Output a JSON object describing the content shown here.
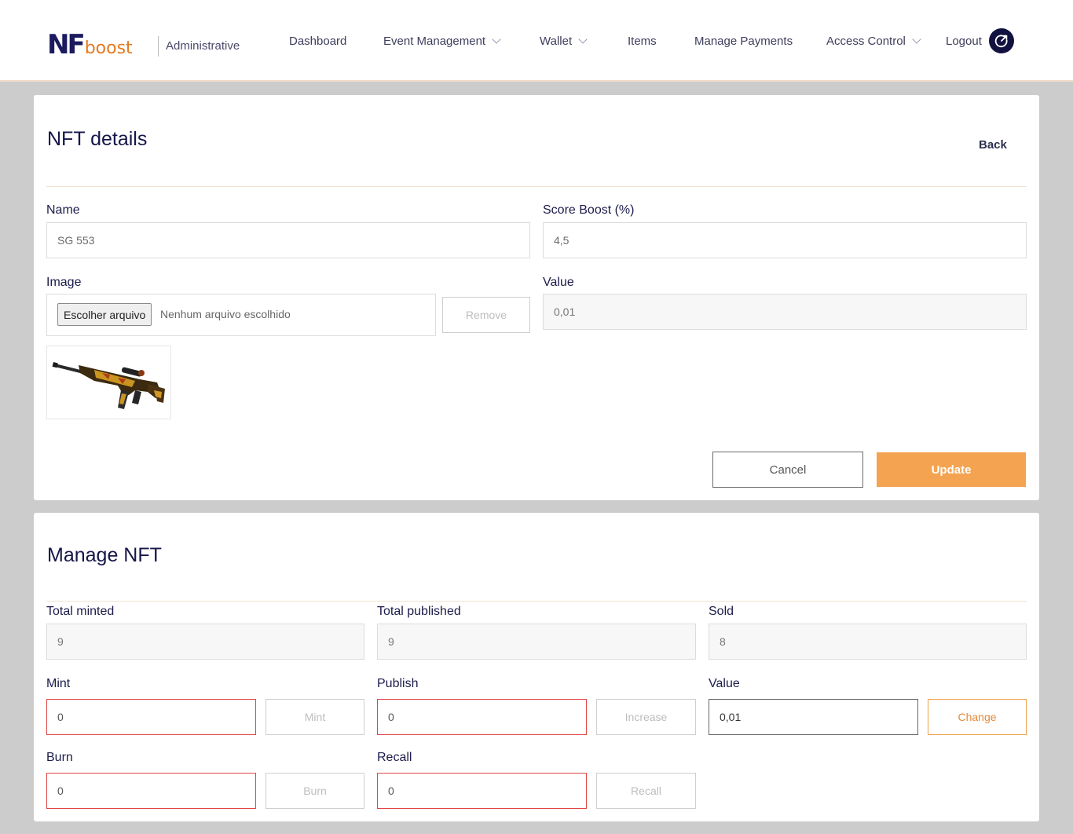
{
  "brand": {
    "nf": "NF",
    "boost": "boost",
    "admin": "Administrative"
  },
  "nav": {
    "dashboard": "Dashboard",
    "event_management": "Event Management",
    "wallet": "Wallet",
    "items": "Items",
    "manage_payments": "Manage Payments",
    "access_control": "Access Control",
    "logout": "Logout"
  },
  "details": {
    "title": "NFT details",
    "back": "Back",
    "name_label": "Name",
    "name_value": "SG 553",
    "score_label": "Score Boost (%)",
    "score_value": "4,5",
    "image_label": "Image",
    "file_button": "Escolher arquivo",
    "file_none": "Nenhum arquivo escolhido",
    "remove": "Remove",
    "value_label": "Value",
    "value_value": "0,01",
    "cancel": "Cancel",
    "update": "Update"
  },
  "manage": {
    "title": "Manage NFT",
    "total_minted_label": "Total minted",
    "total_minted_value": "9",
    "total_published_label": "Total published",
    "total_published_value": "9",
    "sold_label": "Sold",
    "sold_value": "8",
    "mint_label": "Mint",
    "mint_value": "0",
    "mint_button": "Mint",
    "publish_label": "Publish",
    "publish_value": "0",
    "increase_button": "Increase",
    "value_label": "Value",
    "value_value": "0,01",
    "change_button": "Change",
    "burn_label": "Burn",
    "burn_value": "0",
    "burn_button": "Burn",
    "recall_label": "Recall",
    "recall_value": "0",
    "recall_button": "Recall"
  },
  "icons": {
    "logout": "logout-power-icon",
    "chevron": "chevron-down-icon",
    "nft_image": "rifle-image"
  },
  "colors": {
    "accent": "#f4a350",
    "brand_navy": "#1b1b5e",
    "error_border": "#e04646"
  }
}
